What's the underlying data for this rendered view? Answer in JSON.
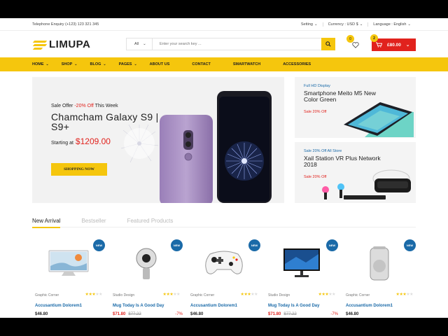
{
  "topbar": {
    "phone": "Telephone Enquiry (+123) 123 321 345",
    "setting": "Setting",
    "currency": "Currency : USD $",
    "language": "Language : English"
  },
  "header": {
    "logo_text": "LIMUPA",
    "search_category": "All",
    "search_placeholder": "Enter your search key ...",
    "wishlist_count": "0",
    "cart_count": "2",
    "cart_total": "£80.00"
  },
  "nav": {
    "items": [
      {
        "label": "Home",
        "dropdown": true
      },
      {
        "label": "Shop",
        "dropdown": true
      },
      {
        "label": "Blog",
        "dropdown": true
      },
      {
        "label": "Pages",
        "dropdown": true
      },
      {
        "label": "About Us",
        "dropdown": false
      },
      {
        "label": "Contact",
        "dropdown": false
      },
      {
        "label": "Smartwatch",
        "dropdown": false
      },
      {
        "label": "Accessories",
        "dropdown": false
      }
    ]
  },
  "main_banner": {
    "offer_prefix": "Sale Offer",
    "offer_highlight": "-20% Off",
    "offer_suffix": "This Week",
    "title": "Chamcham Galaxy S9 | S9+",
    "price_label": "Starting at",
    "price": "$1209.00",
    "button": "SHOPPING NOW"
  },
  "side_banners": [
    {
      "small": "Full HD Display",
      "title": "Smartphone Meito M5 New Color Green",
      "sale": "Sale 20% Off"
    },
    {
      "small": "Sale 20% Off All Store",
      "title": "Xail Station VR Plus Network 2018",
      "sale": "Sale 20% Off"
    }
  ],
  "tabs": [
    "New Arrival",
    "Bestseller",
    "Featured Products"
  ],
  "products": [
    {
      "vendor": "Graphic Corner",
      "name": "Accusantium Dolorem1",
      "price": "$46.80",
      "old_price": "",
      "discount": "",
      "rating": 3,
      "badge": "NEW"
    },
    {
      "vendor": "Studio Design",
      "name": "Mug Today Is A Good Day",
      "price": "$71.80",
      "old_price": "$77.22",
      "discount": "-7%",
      "rating": 3,
      "badge": "NEW"
    },
    {
      "vendor": "Graphic Corner",
      "name": "Accusantium Dolorem1",
      "price": "$46.80",
      "old_price": "",
      "discount": "",
      "rating": 3,
      "badge": "NEW"
    },
    {
      "vendor": "Studio Design",
      "name": "Mug Today Is A Good Day",
      "price": "$71.80",
      "old_price": "$77.22",
      "discount": "-7%",
      "rating": 3,
      "badge": "NEW"
    },
    {
      "vendor": "Graphic Corner",
      "name": "Accusantium Dolorem1",
      "price": "$46.80",
      "old_price": "",
      "discount": "",
      "rating": 3,
      "badge": "NEW"
    }
  ],
  "colors": {
    "accent": "#f5c60d",
    "sale": "#e1221d",
    "link": "#1a6aa8"
  }
}
